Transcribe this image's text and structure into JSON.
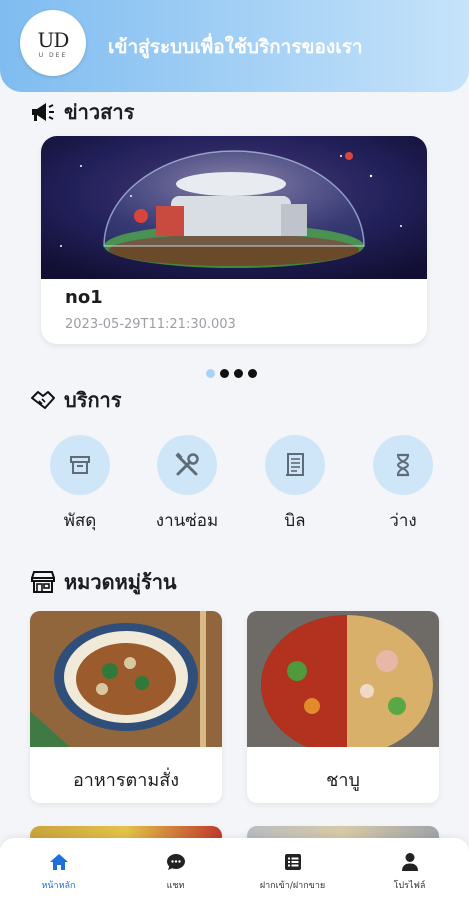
{
  "header": {
    "logo_text": "UD",
    "logo_sub": "U DEE",
    "title": "เข้าสู่ระบบเพื่อใช้บริการของเรา"
  },
  "news": {
    "section_title": "ข่าวสาร",
    "card": {
      "title": "no1",
      "date": "2023-05-29T11:21:30.003"
    },
    "carousel": {
      "count": 4,
      "active_index": 0
    }
  },
  "services": {
    "section_title": "บริการ",
    "items": [
      {
        "label": "พัสดุ",
        "icon": "archive-box-icon"
      },
      {
        "label": "งานซ่อม",
        "icon": "tools-icon"
      },
      {
        "label": "บิล",
        "icon": "receipt-icon"
      },
      {
        "label": "ว่าง",
        "icon": "hourglass-icon"
      }
    ]
  },
  "categories": {
    "section_title": "หมวดหมู่ร้าน",
    "items": [
      {
        "label": "อาหารตามสั่ง"
      },
      {
        "label": "ชาบู"
      }
    ]
  },
  "tabbar": {
    "items": [
      {
        "label": "หน้าหลัก",
        "icon": "home-icon",
        "active": true
      },
      {
        "label": "แชท",
        "icon": "chat-icon",
        "active": false
      },
      {
        "label": "ฝากเข้า/ฝากขาย",
        "icon": "list-icon",
        "active": false
      },
      {
        "label": "โปรไฟล์",
        "icon": "user-icon",
        "active": false
      }
    ]
  },
  "colors": {
    "accent": "#1e6fd9",
    "header_start": "#7fbcf0",
    "header_end": "#c6e3fa",
    "service_circle": "#cfe6f8"
  }
}
